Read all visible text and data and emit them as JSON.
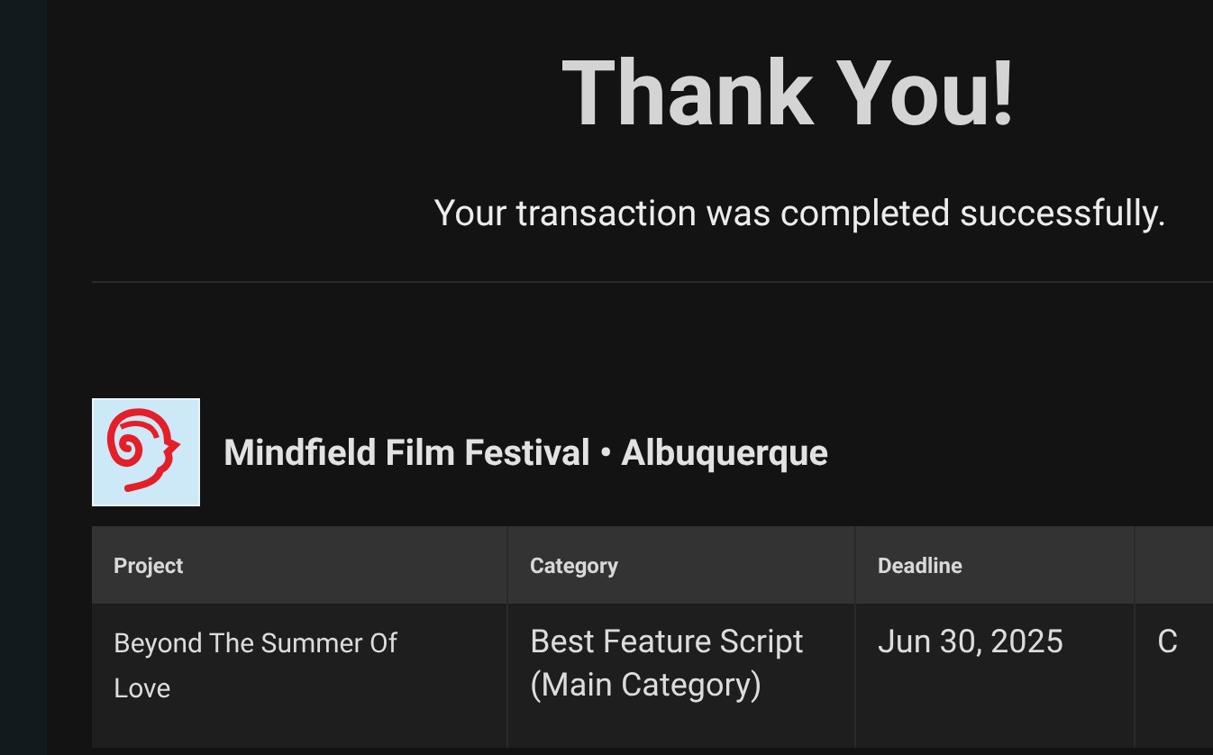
{
  "heading": "Thank You!",
  "message": "Your transaction was completed successfully.",
  "festival": {
    "name": "Mindfield Film Festival • Albuquerque"
  },
  "table": {
    "columns": [
      "Project",
      "Category",
      "Deadline"
    ],
    "rows": [
      {
        "cells": [
          "Beyond The Summer Of Love",
          "Best Feature Script (Main Category)",
          "Jun 30, 2025",
          "C"
        ]
      }
    ]
  }
}
